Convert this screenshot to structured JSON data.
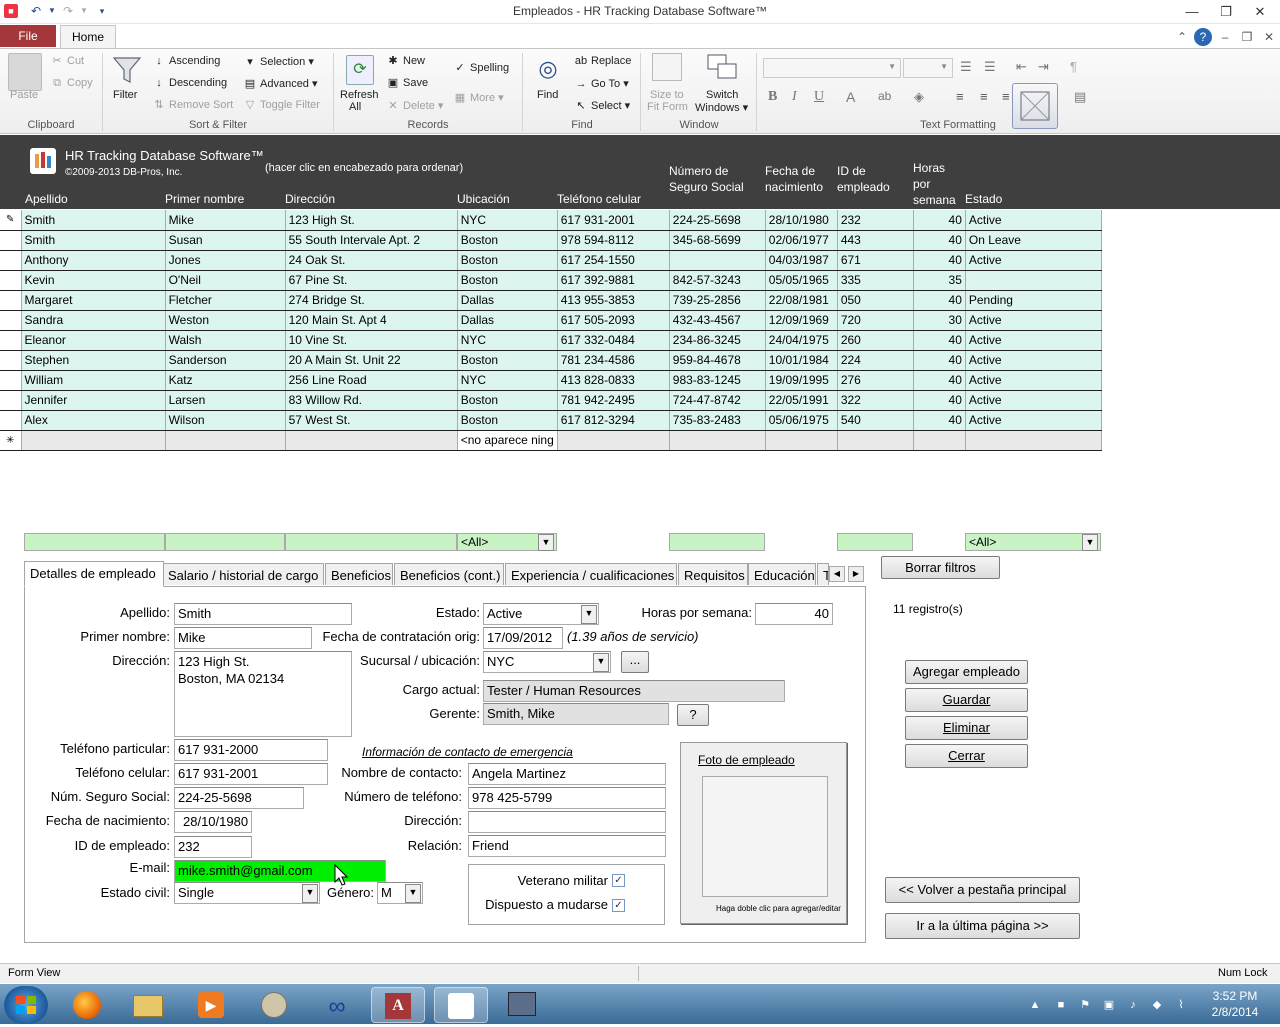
{
  "window": {
    "title": "Empleados - HR Tracking Database Software™"
  },
  "ribbon": {
    "file_tab": "File",
    "home_tab": "Home",
    "clipboard": {
      "label": "Clipboard",
      "paste": "Paste",
      "cut": "Cut",
      "copy": "Copy"
    },
    "sort_filter": {
      "label": "Sort & Filter",
      "filter": "Filter",
      "ascending": "Ascending",
      "descending": "Descending",
      "remove_sort": "Remove Sort",
      "selection": "Selection",
      "advanced": "Advanced",
      "toggle_filter": "Toggle Filter"
    },
    "records": {
      "label": "Records",
      "refresh": "Refresh",
      "refresh_all": "All",
      "new": "New",
      "save": "Save",
      "delete": "Delete",
      "spelling": "Spelling",
      "more": "More"
    },
    "find": {
      "label": "Find",
      "find": "Find",
      "replace": "Replace",
      "goto": "Go To",
      "select": "Select"
    },
    "window_grp": {
      "label": "Window",
      "size_to_fit1": "Size to",
      "size_to_fit2": "Fit Form",
      "switch1": "Switch",
      "switch2": "Windows"
    },
    "text_formatting": {
      "label": "Text Formatting"
    }
  },
  "header": {
    "app_title": "HR Tracking Database Software™",
    "copyright": "©2009-2013 DB-Pros, Inc.",
    "hint": "(hacer clic en encabezado para ordenar)",
    "columns": {
      "apellido": "Apellido",
      "primer_nombre": "Primer nombre",
      "direccion": "Dirección",
      "ubicacion": "Ubicación",
      "telefono": "Teléfono celular",
      "ssn1": "Número de",
      "ssn2": "Seguro Social",
      "dob1": "Fecha de",
      "dob2": "nacimiento",
      "id1": "ID de",
      "id2": "empleado",
      "horas1": "Horas",
      "horas2": "por",
      "horas3": "semana",
      "estado": "Estado"
    }
  },
  "rows": [
    [
      "Smith",
      "Mike",
      "123 High St.",
      "NYC",
      "617 931-2001",
      "224-25-5698",
      "28/10/1980",
      "232",
      "40",
      "Active"
    ],
    [
      "Smith",
      "Susan",
      "55 South Intervale Apt. 2",
      "Boston",
      "978 594-8112",
      "345-68-5699",
      "02/06/1977",
      "443",
      "40",
      "On Leave"
    ],
    [
      "Anthony",
      "Jones",
      "24 Oak St.",
      "Boston",
      "617 254-1550",
      "",
      "04/03/1987",
      "671",
      "40",
      "Active"
    ],
    [
      "Kevin",
      "O'Neil",
      "67 Pine St.",
      "Boston",
      "617 392-9881",
      "842-57-3243",
      "05/05/1965",
      "335",
      "35",
      ""
    ],
    [
      "Margaret",
      "Fletcher",
      "274 Bridge St.",
      "Dallas",
      "413 955-3853",
      "739-25-2856",
      "22/08/1981",
      "050",
      "40",
      "Pending"
    ],
    [
      "Sandra",
      "Weston",
      "120 Main St. Apt 4",
      "Dallas",
      "617 505-2093",
      "432-43-4567",
      "12/09/1969",
      "720",
      "30",
      "Active"
    ],
    [
      "Eleanor",
      "Walsh",
      "10 Vine St.",
      "NYC",
      "617 332-0484",
      "234-86-3245",
      "24/04/1975",
      "260",
      "40",
      "Active"
    ],
    [
      "Stephen",
      "Sanderson",
      "20 A Main St. Unit 22",
      "Boston",
      "781 234-4586",
      "959-84-4678",
      "10/01/1984",
      "224",
      "40",
      "Active"
    ],
    [
      "William",
      "Katz",
      "256 Line Road",
      "NYC",
      "413 828-0833",
      "983-83-1245",
      "19/09/1995",
      "276",
      "40",
      "Active"
    ],
    [
      "Jennifer",
      "Larsen",
      "83 Willow Rd.",
      "Boston",
      "781 942-2495",
      "724-47-8742",
      "22/05/1991",
      "322",
      "40",
      "Active"
    ],
    [
      "Alex",
      "Wilson",
      "57 West St.",
      "Boston",
      "617 812-3294",
      "735-83-2483",
      "05/06/1975",
      "540",
      "40",
      "Active"
    ]
  ],
  "new_row": {
    "ubicacion": "<no aparece ning"
  },
  "filters": {
    "ubicacion": "<All>",
    "estado": "<All>"
  },
  "tabs": [
    "Detalles de empleado",
    "Salario / historial de cargo",
    "Beneficios",
    "Beneficios (cont.)",
    "Experiencia / cualificaciones",
    "Requisitos",
    "Educación",
    "T"
  ],
  "actions": {
    "borrar_filtros": "Borrar filtros",
    "registros": "11 registro(s)",
    "agregar": "Agregar empleado",
    "guardar": "Guardar",
    "eliminar": "Eliminar",
    "cerrar": "Cerrar",
    "volver": "<< Volver a pestaña principal",
    "ultima": "Ir a la última página >>"
  },
  "form": {
    "labels": {
      "apellido": "Apellido:",
      "primer_nombre": "Primer nombre:",
      "direccion": "Dirección:",
      "tel_particular": "Teléfono particular:",
      "tel_celular": "Teléfono celular:",
      "ssn": "Núm. Seguro Social:",
      "dob": "Fecha de nacimiento:",
      "id": "ID de empleado:",
      "email": "E-mail:",
      "estado_civil": "Estado civil:",
      "genero": "Género:",
      "estado": "Estado:",
      "horas": "Horas por semana:",
      "contratacion": "Fecha de contratación orig:",
      "sucursal": "Sucursal / ubicación:",
      "cargo": "Cargo actual:",
      "gerente": "Gerente:",
      "emergencia": "Información de contacto de emergencia",
      "contacto": "Nombre de contacto:",
      "numero_tel": "Número de teléfono:",
      "dir_contacto": "Dirección:",
      "relacion": "Relación:",
      "veterano": "Veterano militar",
      "mudarse": "Dispuesto a mudarse",
      "foto": "Foto de empleado",
      "foto_hint": "Haga doble clic para agregar/editar"
    },
    "values": {
      "apellido": "Smith",
      "primer_nombre": "Mike",
      "direccion1": "123 High St.",
      "direccion2": "Boston, MA 02134",
      "tel_particular": "617 931-2000",
      "tel_celular": "617 931-2001",
      "ssn": "224-25-5698",
      "dob": "28/10/1980",
      "id": "232",
      "email": "mike.smith@gmail.com",
      "estado_civil": "Single",
      "genero": "M",
      "estado": "Active",
      "horas": "40",
      "contratacion": "17/09/2012",
      "servicio": "(1.39 años de servicio)",
      "sucursal": "NYC",
      "cargo": "Tester / Human Resources",
      "gerente": "Smith, Mike",
      "contacto": "Angela Martinez",
      "numero_tel": "978 425-5799",
      "dir_contacto": "",
      "relacion": "Friend",
      "veterano": true,
      "mudarse": true
    },
    "ellipsis_btn": "...",
    "question_btn": "?"
  },
  "status": {
    "left": "Form View",
    "right": "Num Lock"
  },
  "clock": {
    "time": "3:52 PM",
    "date": "2/8/2014"
  },
  "colors": {
    "file_tab": "#a4373a",
    "header_bg": "#3f3f3f",
    "row_bg": "#dcf5f1",
    "filter_bg": "#c9f2c5",
    "email_bg": "#00ee00"
  }
}
